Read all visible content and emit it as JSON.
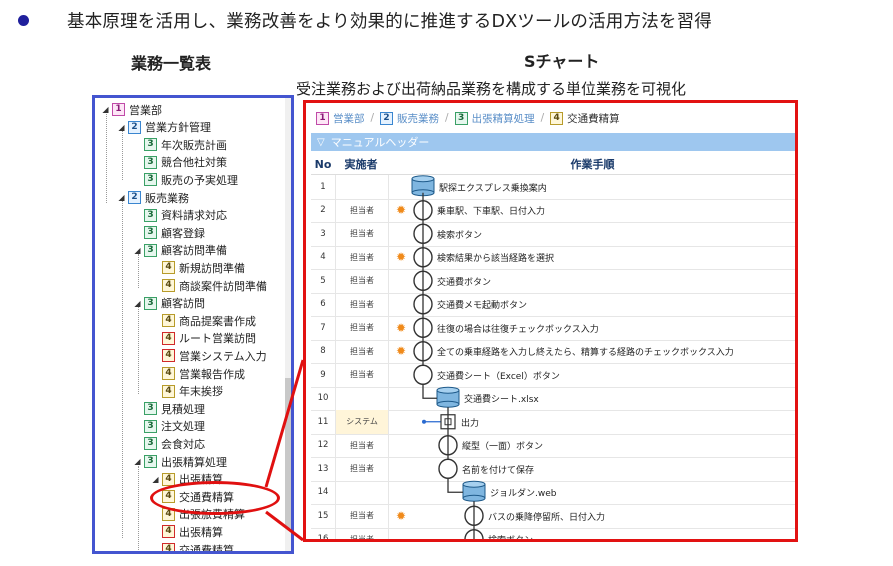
{
  "headline": "基本原理を活用し、業務改善をより効果的に推進するDXツールの活用方法を習得",
  "left_label": "業務一覧表",
  "right_label": "Sチャート",
  "right_sublabel": "受注業務および出荷納品業務を構成する単位業務を可視化",
  "tree": [
    {
      "level": "1",
      "label": "営業部"
    },
    {
      "level": "2",
      "label": "営業方針管理"
    },
    {
      "level": "3",
      "label": "年次販売計画"
    },
    {
      "level": "3",
      "label": "競合他社対策"
    },
    {
      "level": "3",
      "label": "販売の予実処理"
    },
    {
      "level": "2",
      "label": "販売業務"
    },
    {
      "level": "3",
      "label": "資料請求対応"
    },
    {
      "level": "3",
      "label": "顧客登録"
    },
    {
      "level": "3",
      "label": "顧客訪問準備"
    },
    {
      "level": "4",
      "label": "新規訪問準備"
    },
    {
      "level": "4",
      "label": "商談案件訪問準備"
    },
    {
      "level": "3",
      "label": "顧客訪問"
    },
    {
      "level": "4",
      "label": "商品提案書作成"
    },
    {
      "level": "4",
      "label": "ルート営業訪問"
    },
    {
      "level": "4",
      "label": "営業システム入力"
    },
    {
      "level": "4",
      "label": "営業報告作成"
    },
    {
      "level": "4",
      "label": "年末挨拶"
    },
    {
      "level": "3",
      "label": "見積処理"
    },
    {
      "level": "3",
      "label": "注文処理"
    },
    {
      "level": "3",
      "label": "会食対応"
    },
    {
      "level": "3",
      "label": "出張精算処理"
    },
    {
      "level": "4",
      "label": "出張精算"
    },
    {
      "level": "4",
      "label": "交通費精算"
    },
    {
      "level": "4",
      "label": "出張旅費精算"
    },
    {
      "level": "4",
      "label": "出張精算"
    },
    {
      "level": "4",
      "label": "交通費精算"
    }
  ],
  "breadcrumb": [
    {
      "level": "1",
      "label": "営業部"
    },
    {
      "level": "2",
      "label": "販売業務"
    },
    {
      "level": "3",
      "label": "出張精算処理"
    },
    {
      "level": "4",
      "label": "交通費精算"
    }
  ],
  "manual_header": "マニュアルヘッダー",
  "columns": {
    "no": "No",
    "actor": "実施者",
    "steps": "作業手順"
  },
  "rows": [
    {
      "no": "1",
      "actor": "",
      "sun": false,
      "text": "駅探エクスプレス乗換案内"
    },
    {
      "no": "2",
      "actor": "担当者",
      "sun": true,
      "text": "乗車駅、下車駅、日付入力"
    },
    {
      "no": "3",
      "actor": "担当者",
      "sun": false,
      "text": "検索ボタン"
    },
    {
      "no": "4",
      "actor": "担当者",
      "sun": true,
      "text": "検索結果から該当経路を選択"
    },
    {
      "no": "5",
      "actor": "担当者",
      "sun": false,
      "text": "交通費ボタン"
    },
    {
      "no": "6",
      "actor": "担当者",
      "sun": false,
      "text": "交通費メモ起動ボタン"
    },
    {
      "no": "7",
      "actor": "担当者",
      "sun": true,
      "text": "往復の場合は往復チェックボックス入力"
    },
    {
      "no": "8",
      "actor": "担当者",
      "sun": true,
      "text": "全ての乗車経路を入力し終えたら、精算する経路のチェックボックス入力"
    },
    {
      "no": "9",
      "actor": "担当者",
      "sun": false,
      "text": "交通費シート（Excel）ボタン"
    },
    {
      "no": "10",
      "actor": "",
      "sun": false,
      "text": "交通費シート.xlsx"
    },
    {
      "no": "11",
      "actor": "システム",
      "sun": false,
      "text": "出力"
    },
    {
      "no": "12",
      "actor": "担当者",
      "sun": false,
      "text": "縦型（一面）ボタン"
    },
    {
      "no": "13",
      "actor": "担当者",
      "sun": false,
      "text": "名前を付けて保存"
    },
    {
      "no": "14",
      "actor": "",
      "sun": false,
      "text": "ジョルダン.web"
    },
    {
      "no": "15",
      "actor": "担当者",
      "sun": true,
      "text": "バスの乗降停留所、日付入力"
    },
    {
      "no": "16",
      "actor": "担当者",
      "sun": false,
      "text": "検索ボタン"
    }
  ],
  "colors": {
    "tree_border": "#4455d0",
    "panel_border": "#e21212",
    "manual_header_bg": "#9ec7ef",
    "accent_orange": "#f08a1a"
  }
}
